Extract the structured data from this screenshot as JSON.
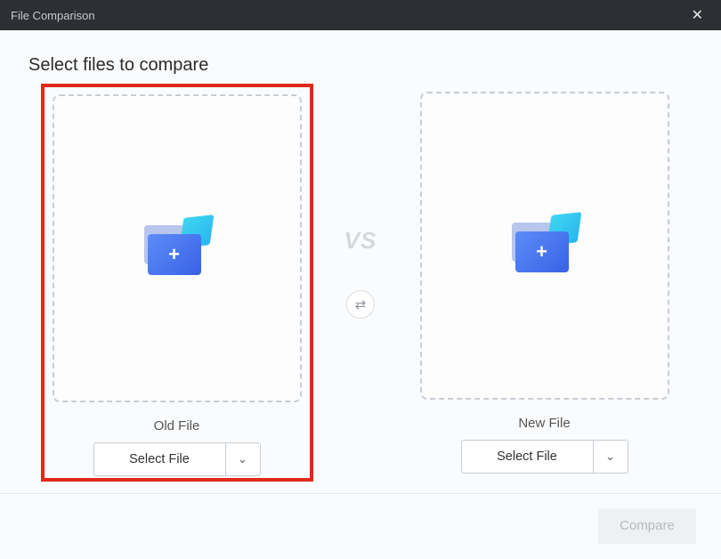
{
  "window": {
    "title": "File Comparison"
  },
  "heading": "Select files to compare",
  "vs": "VS",
  "panels": {
    "left": {
      "label": "Old File",
      "select": "Select File"
    },
    "right": {
      "label": "New File",
      "select": "Select File"
    }
  },
  "actions": {
    "compare": "Compare"
  }
}
